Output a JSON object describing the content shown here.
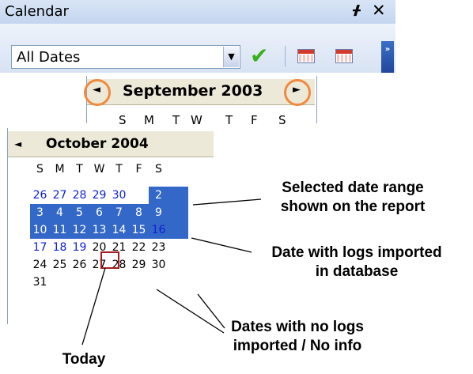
{
  "panel": {
    "title": "Calendar",
    "pin_icon": "pin-icon",
    "close_icon": "close-icon",
    "filter_value": "All Dates",
    "dropdown_icon": "chevron-down-icon",
    "apply_icon": "checkmark-icon",
    "view_icons": [
      "calendar-view-icon",
      "calendar-grid-icon"
    ],
    "overflow_icon": "toolbar-overflow-icon"
  },
  "calendar_top": {
    "month": "September 2003",
    "prev_glyph": "◄",
    "next_glyph": "►",
    "weekdays": [
      "S",
      "M",
      "T",
      "W",
      "T",
      "F",
      "S"
    ]
  },
  "calendar": {
    "month": "October 2004",
    "prev_glyph": "◄",
    "weekdays": [
      "S",
      "M",
      "T",
      "W",
      "T",
      "F",
      "S"
    ],
    "weeks": [
      [
        {
          "d": "26",
          "s": "blue"
        },
        {
          "d": "27",
          "s": "blue"
        },
        {
          "d": "28",
          "s": "blue"
        },
        {
          "d": "29",
          "s": "blue"
        },
        {
          "d": "30",
          "s": "blue"
        },
        {
          "d": "1",
          "s": "sel"
        },
        {
          "d": "2",
          "s": "sel"
        }
      ],
      [
        {
          "d": "3",
          "s": "sel"
        },
        {
          "d": "4",
          "s": "sel"
        },
        {
          "d": "5",
          "s": "sel"
        },
        {
          "d": "6",
          "s": "sel"
        },
        {
          "d": "7",
          "s": "sel"
        },
        {
          "d": "8",
          "s": "sel"
        },
        {
          "d": "9",
          "s": "sel"
        }
      ],
      [
        {
          "d": "10",
          "s": "sel"
        },
        {
          "d": "11",
          "s": "sel"
        },
        {
          "d": "12",
          "s": "sel"
        },
        {
          "d": "13",
          "s": "sel"
        },
        {
          "d": "14",
          "s": "sel"
        },
        {
          "d": "15",
          "s": "sel"
        },
        {
          "d": "16",
          "s": "blue"
        }
      ],
      [
        {
          "d": "17",
          "s": "blue"
        },
        {
          "d": "18",
          "s": "blue"
        },
        {
          "d": "19",
          "s": "blue"
        },
        {
          "d": "20",
          "s": "today"
        },
        {
          "d": "21",
          "s": "plain"
        },
        {
          "d": "22",
          "s": "plain"
        },
        {
          "d": "23",
          "s": "plain"
        }
      ],
      [
        {
          "d": "24",
          "s": "plain"
        },
        {
          "d": "25",
          "s": "plain"
        },
        {
          "d": "26",
          "s": "plain"
        },
        {
          "d": "27",
          "s": "plain"
        },
        {
          "d": "28",
          "s": "plain"
        },
        {
          "d": "29",
          "s": "plain"
        },
        {
          "d": "30",
          "s": "plain"
        }
      ],
      [
        {
          "d": "31",
          "s": "plain"
        }
      ]
    ]
  },
  "annotations": {
    "selected_range": "Selected date range\nshown on the report",
    "logs_imported": "Date with logs imported\nin database",
    "no_logs": "Dates with no logs\nimported / No info",
    "today": "Today"
  },
  "colors": {
    "selection": "#3468c8",
    "imported_day": "#0d1fd6",
    "today_border": "#a51d1d",
    "highlight_ring": "#f08a3e",
    "title_bar": "#c3d5ef"
  }
}
